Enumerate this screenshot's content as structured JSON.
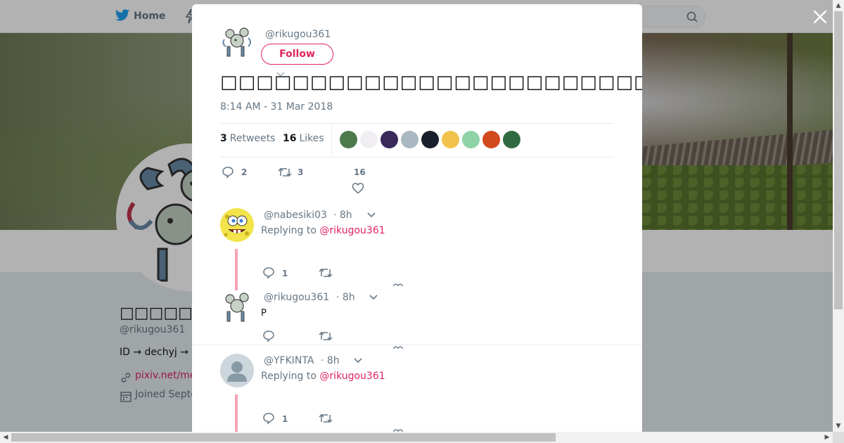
{
  "nav": {
    "home_label": "Home"
  },
  "profile": {
    "name": "□□□□□",
    "handle": "@rikugou361",
    "bio": "ID → dechyj  →",
    "link": "pixiv.net/me",
    "joined": "Joined Septe"
  },
  "tweet": {
    "author_handle": "@rikugou361",
    "follow_label": "Follow",
    "text": "□□□□□□□□□□□□□□□□□□□□□□□□□□□□□□□□□□□□□□□□□□□□□□□□",
    "timestamp": "8:14 AM - 31 Mar 2018",
    "retweets_count": "3",
    "retweets_label": "Retweets",
    "likes_count": "16",
    "likes_label": "Likes",
    "liker_colors": [
      "#4c7a4a",
      "#f0eef2",
      "#3a2a5a",
      "#aab8c2",
      "#1a1f2e",
      "#f2c34b",
      "#8fd3a6",
      "#d2491d",
      "#2f6b3e"
    ],
    "replies_count": "2",
    "retweet_action_count": "3",
    "like_action_count": "16"
  },
  "replies": [
    {
      "handle": "@nabesiki03",
      "time": "· 8h",
      "replying_prefix": "Replying to",
      "replying_to": "@rikugou361",
      "reply_count": "1"
    },
    {
      "handle": "@rikugou361",
      "time": "· 8h",
      "text": "P"
    },
    {
      "handle": "@YFKINTA",
      "time": "· 8h",
      "replying_prefix": "Replying to",
      "replying_to": "@rikugou361",
      "reply_count": "1"
    }
  ],
  "colors": {
    "accent": "#e0245e",
    "thread_line": "#f5a3b7",
    "muted_text": "#657786"
  }
}
